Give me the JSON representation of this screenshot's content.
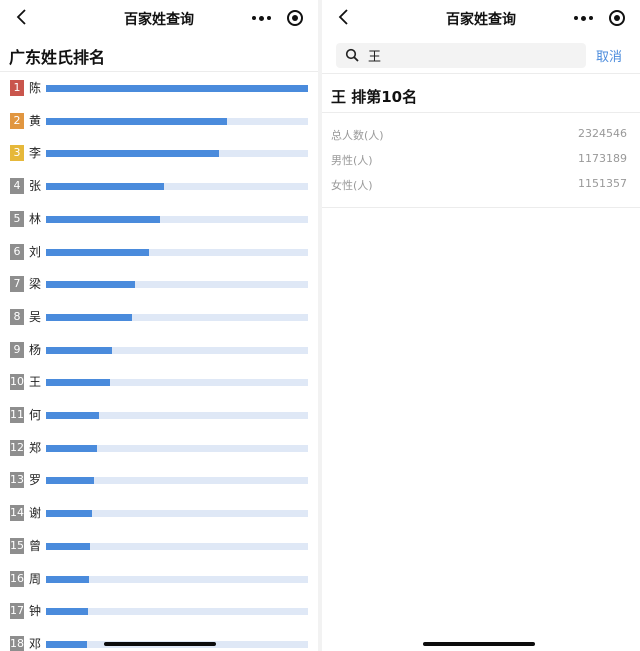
{
  "left": {
    "nav_title": "百家姓查询",
    "page_title": "广东姓氏排名",
    "colors": {
      "bar_fill": "#4a8bdc",
      "bar_track": "#dfe8f6",
      "rank_1": "#c9554c",
      "rank_2": "#e19640",
      "rank_3": "#e6b83a",
      "rank_other": "#8e8e8e"
    },
    "ranking": [
      {
        "rank": "1",
        "name": "陈",
        "share": 1.0
      },
      {
        "rank": "2",
        "name": "黄",
        "share": 0.692
      },
      {
        "rank": "3",
        "name": "李",
        "share": 0.661
      },
      {
        "rank": "4",
        "name": "张",
        "share": 0.45
      },
      {
        "rank": "5",
        "name": "林",
        "share": 0.435
      },
      {
        "rank": "6",
        "name": "刘",
        "share": 0.393
      },
      {
        "rank": "7",
        "name": "梁",
        "share": 0.34
      },
      {
        "rank": "8",
        "name": "吴",
        "share": 0.328
      },
      {
        "rank": "9",
        "name": "杨",
        "share": 0.252
      },
      {
        "rank": "10",
        "name": "王",
        "share": 0.244
      },
      {
        "rank": "11",
        "name": "何",
        "share": 0.202
      },
      {
        "rank": "12",
        "name": "郑",
        "share": 0.195
      },
      {
        "rank": "13",
        "name": "罗",
        "share": 0.183
      },
      {
        "rank": "14",
        "name": "谢",
        "share": 0.176
      },
      {
        "rank": "15",
        "name": "曾",
        "share": 0.168
      },
      {
        "rank": "16",
        "name": "周",
        "share": 0.164
      },
      {
        "rank": "17",
        "name": "钟",
        "share": 0.16
      },
      {
        "rank": "18",
        "name": "邓",
        "share": 0.155
      }
    ]
  },
  "right": {
    "nav_title": "百家姓查询",
    "search": {
      "value": "王",
      "placeholder": ""
    },
    "cancel_label": "取消",
    "result_title": "王 排第10名",
    "stats": [
      {
        "label": "总人数(人)",
        "value": "2324546"
      },
      {
        "label": "男性(人)",
        "value": "1173189"
      },
      {
        "label": "女性(人)",
        "value": "1151357"
      }
    ]
  }
}
